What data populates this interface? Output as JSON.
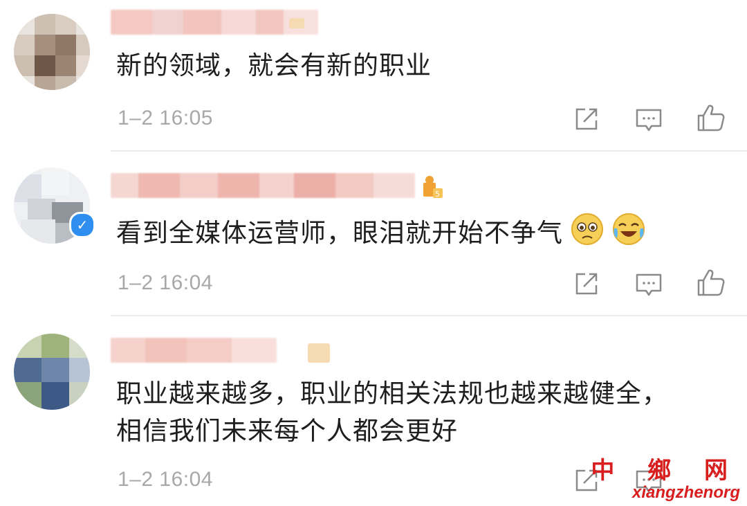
{
  "comments": [
    {
      "text_lines": [
        "新的领域，就会有新的职业"
      ],
      "time": "1–2 16:05",
      "actions": [
        "share-icon",
        "comment-icon",
        "like-icon"
      ]
    },
    {
      "text_lines": [
        "看到全媒体运营师，眼泪就开始不争气"
      ],
      "emojis": [
        "sad-face-icon",
        "laughing-crying-icon"
      ],
      "time": "1–2 16:04",
      "verified": "✓",
      "actions": [
        "share-icon",
        "comment-icon",
        "like-icon"
      ]
    },
    {
      "text_lines": [
        "职业越来越多，职业的相关法规也越来越健全，",
        "相信我们未来每个人都会更好"
      ],
      "time": "1–2 16:04",
      "actions": [
        "share-icon",
        "comment-icon",
        "like-icon"
      ]
    }
  ],
  "watermark": {
    "chinese": "中 鄉 网",
    "english": "xiangzhenorg"
  },
  "colors": {
    "text": "#1e1e1e",
    "meta": "#a8a8a8",
    "divider": "#ececec",
    "verified": "#2f8ff0",
    "watermark": "#d81e1e"
  }
}
